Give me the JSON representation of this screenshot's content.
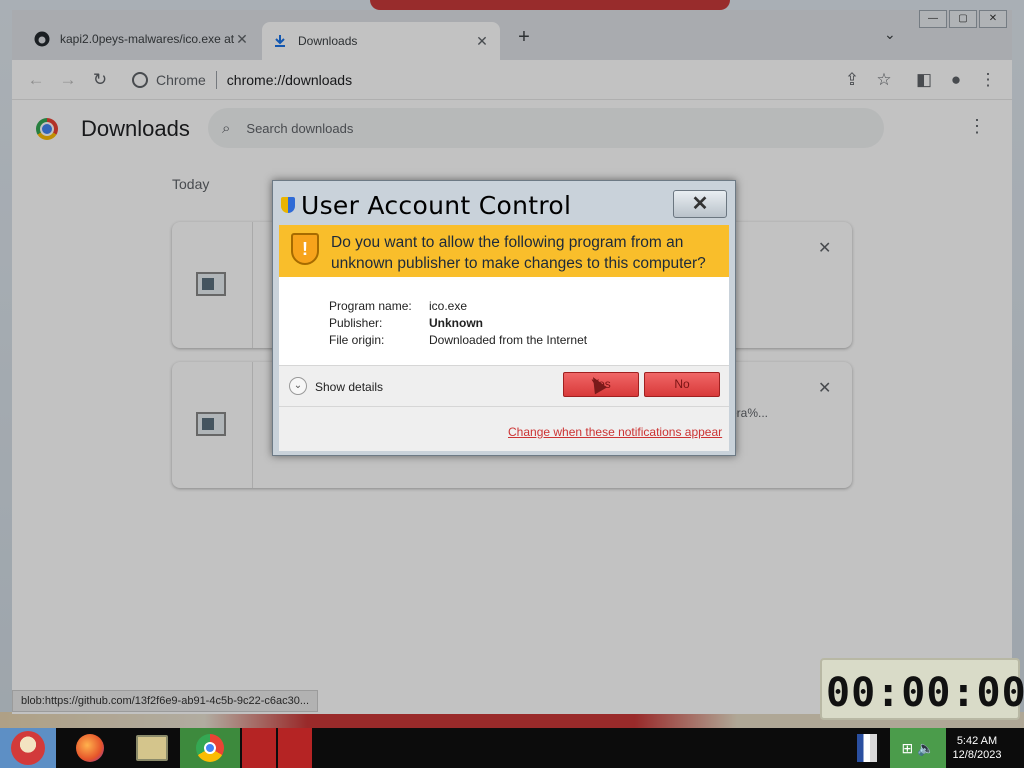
{
  "browser": {
    "tabs": [
      {
        "label": "kapi2.0peys-malwares/ico.exe at",
        "icon": "github-icon",
        "active": false
      },
      {
        "label": "Downloads",
        "icon": "download-icon",
        "active": true
      }
    ],
    "omnibox": {
      "chip": "Chrome",
      "url": "chrome://downloads"
    }
  },
  "downloads_page": {
    "title": "Downloads",
    "search_placeholder": "Search downloads",
    "section": "Today",
    "items": [
      {
        "snippet": ""
      },
      {
        "snippet": "era%..."
      }
    ]
  },
  "status_bar": "blob:https://github.com/13f2f6e9-ab91-4c5b-9c22-c6ac30...",
  "uac": {
    "title": "User Account Control",
    "question": "Do you want to allow the following program from an unknown publisher to make changes to this computer?",
    "fields": [
      {
        "key": "Program name:",
        "value": "ico.exe",
        "bold": false
      },
      {
        "key": "Publisher:",
        "value": "Unknown",
        "bold": true
      },
      {
        "key": "File origin:",
        "value": "Downloaded from the Internet",
        "bold": false
      }
    ],
    "show_details": "Show details",
    "yes_label": "Yes",
    "no_label": "No",
    "link": "Change when these notifications appear"
  },
  "clock_widget": "00:00:00",
  "taskbar": {
    "time": "5:42 AM",
    "date": "12/8/2023",
    "apps": [
      "start-orb",
      "firefox",
      "file-manager",
      "chrome",
      "app",
      "app"
    ]
  },
  "colors": {
    "uac_banner": "#f9be2b",
    "uac_buttons": "#d83a3a",
    "link": "#cc3333"
  }
}
